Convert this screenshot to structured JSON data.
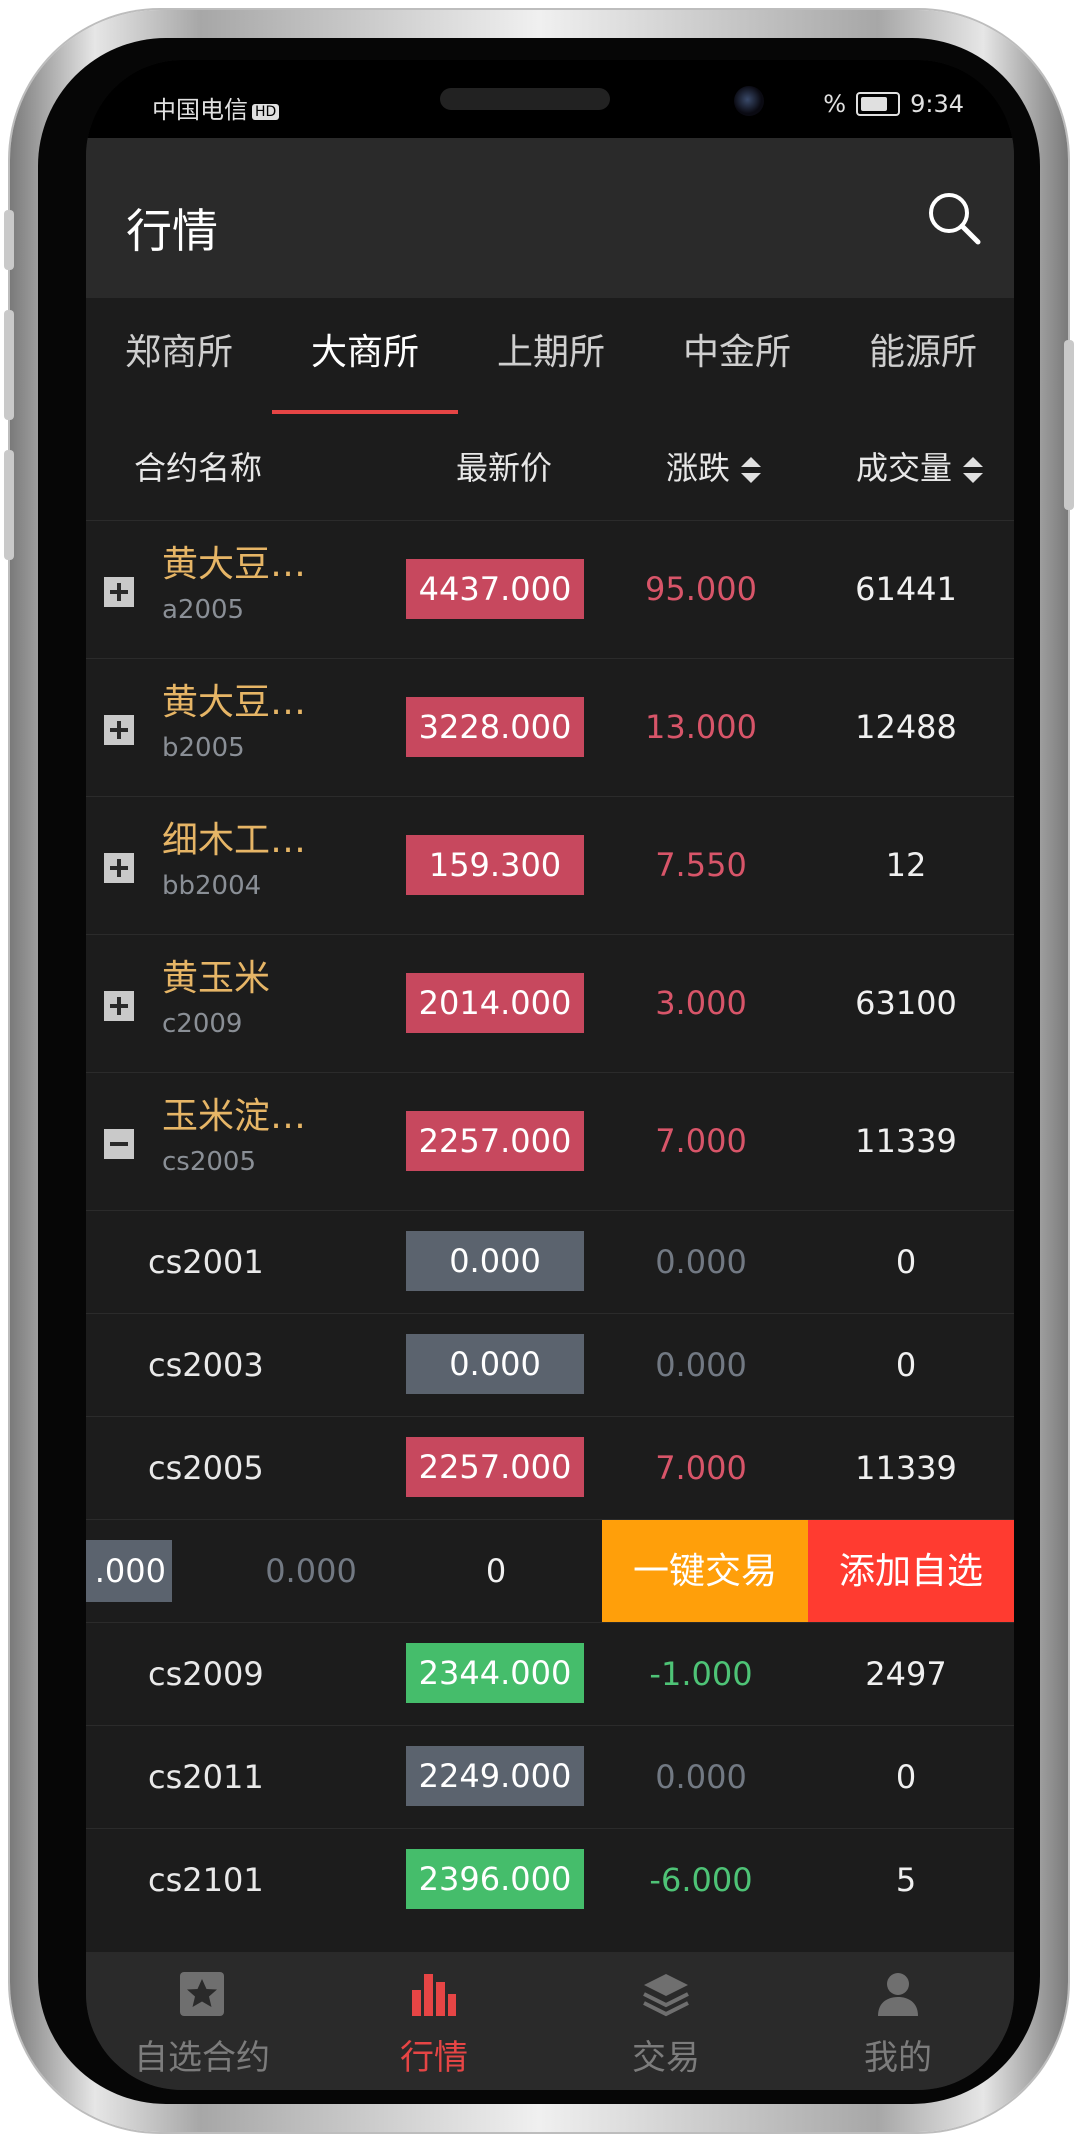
{
  "status": {
    "carrier": "中国电信",
    "hd": "HD",
    "battery_pct": "%",
    "time": "9:34"
  },
  "header": {
    "title": "行情"
  },
  "tabs": [
    {
      "label": "郑商所"
    },
    {
      "label": "大商所"
    },
    {
      "label": "上期所"
    },
    {
      "label": "中金所"
    },
    {
      "label": "能源所"
    }
  ],
  "columns": {
    "name": "合约名称",
    "price": "最新价",
    "change": "涨跌",
    "volume": "成交量"
  },
  "rows": [
    {
      "name": "黄大豆…",
      "code": "a2005",
      "price": "4437.000",
      "change": "95.000",
      "volume": "61441"
    },
    {
      "name": "黄大豆…",
      "code": "b2005",
      "price": "3228.000",
      "change": "13.000",
      "volume": "12488"
    },
    {
      "name": "细木工…",
      "code": "bb2004",
      "price": "159.300",
      "change": "7.550",
      "volume": "12"
    },
    {
      "name": "黄玉米",
      "code": "c2009",
      "price": "2014.000",
      "change": "3.000",
      "volume": "63100"
    },
    {
      "name": "玉米淀…",
      "code": "cs2005",
      "price": "2257.000",
      "change": "7.000",
      "volume": "11339"
    }
  ],
  "subrows": [
    {
      "code": "cs2001",
      "price": "0.000",
      "change": "0.000",
      "volume": "0"
    },
    {
      "code": "cs2003",
      "price": "0.000",
      "change": "0.000",
      "volume": "0"
    },
    {
      "code": "cs2005",
      "price": "2257.000",
      "change": "7.000",
      "volume": "11339"
    },
    {
      "price": ".000",
      "change": "0.000",
      "volume": "0",
      "trade": "一键交易",
      "favorite": "添加自选"
    },
    {
      "code": "cs2009",
      "price": "2344.000",
      "change": "-1.000",
      "volume": "2497"
    },
    {
      "code": "cs2011",
      "price": "2249.000",
      "change": "0.000",
      "volume": "0"
    },
    {
      "code": "cs2101",
      "price": "2396.000",
      "change": "-6.000",
      "volume": "5"
    }
  ],
  "nav": [
    {
      "label": "自选合约",
      "icon": "star-icon"
    },
    {
      "label": "行情",
      "icon": "bar-chart-icon"
    },
    {
      "label": "交易",
      "icon": "layers-icon"
    },
    {
      "label": "我的",
      "icon": "user-icon"
    }
  ],
  "colors": {
    "accent": "#e64545",
    "up": "#c7485e",
    "down": "#45bd6b",
    "flat": "#5b636e",
    "name": "#e6b566",
    "trade": "#ff9f0a",
    "favorite": "#ff3b30"
  }
}
